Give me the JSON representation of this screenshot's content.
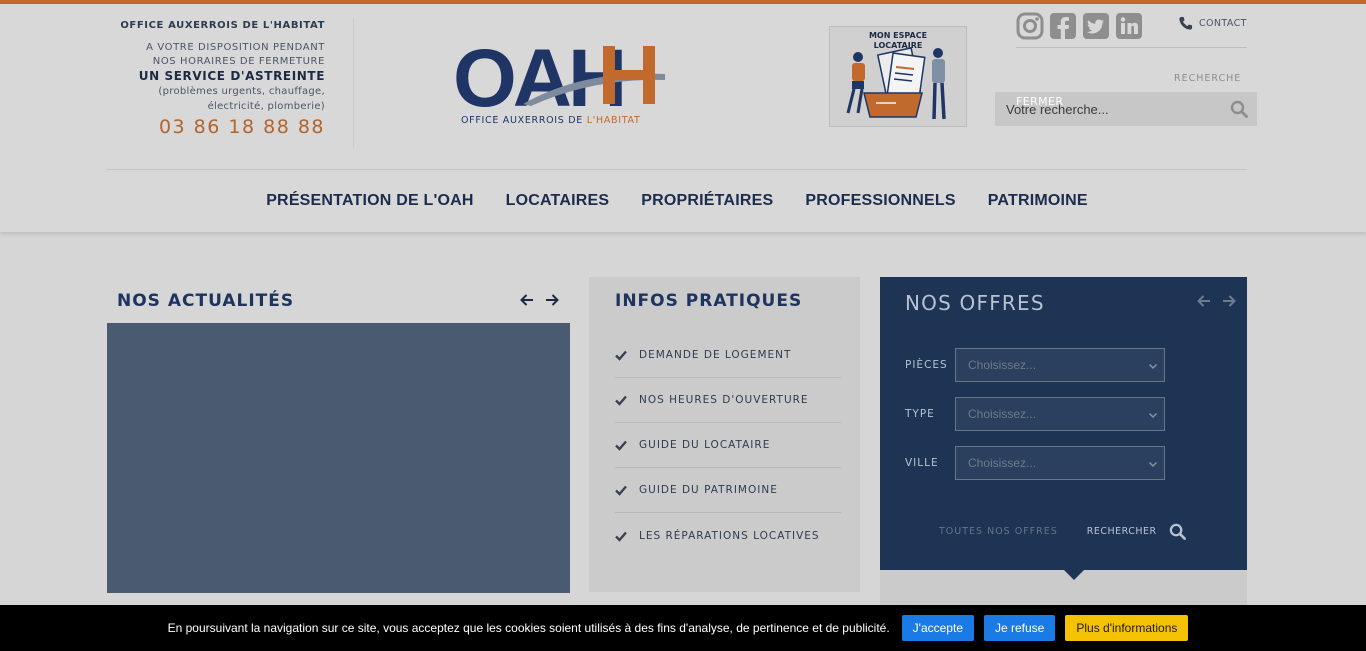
{
  "header": {
    "astreinte": {
      "org": "OFFICE AUXERROIS DE L'HABITAT",
      "line1": "A VOTRE DISPOSITION PENDANT",
      "line2": "NOS HORAIRES DE FERMETURE",
      "service": "UN SERVICE D'ASTREINTE",
      "detail1": "(problèmes urgents, chauffage,",
      "detail2": "électricité, plomberie)",
      "phone": "03 86 18 88 88"
    },
    "logo": {
      "letters": "OAH",
      "subtitle_main": "OFFICE AUXERROIS DE ",
      "subtitle_accent": "L'HABITAT"
    },
    "espace": {
      "label1": "MON ESPACE",
      "label2": "LOCATAIRE"
    },
    "social_icons": [
      "instagram-icon",
      "facebook-icon",
      "twitter-icon",
      "linkedin-icon"
    ],
    "contact_label": "CONTACT",
    "search_label": "RECHERCHE",
    "close_label": "FERMER",
    "search_placeholder": "Votre recherche..."
  },
  "nav": {
    "items": [
      "PRÉSENTATION DE L'OAH",
      "LOCATAIRES",
      "PROPRIÉTAIRES",
      "PROFESSIONNELS",
      "PATRIMOINE"
    ]
  },
  "actualites": {
    "title": "NOS ACTUALITÉS"
  },
  "infos": {
    "title": "INFOS PRATIQUES",
    "items": [
      "DEMANDE DE LOGEMENT",
      "NOS HEURES D'OUVERTURE",
      "GUIDE DU LOCATAIRE",
      "GUIDE DU PATRIMOINE",
      "LES RÉPARATIONS LOCATIVES"
    ]
  },
  "offres": {
    "title": "NOS OFFRES",
    "fields": [
      {
        "label": "PIÈCES",
        "value": "Choisissez..."
      },
      {
        "label": "TYPE",
        "value": "Choisissez..."
      },
      {
        "label": "VILLE",
        "value": "Choisissez..."
      }
    ],
    "all_label": "TOUTES NOS OFFRES",
    "search_label": "RECHERCHER"
  },
  "cookie": {
    "message": "En poursuivant la navigation sur ce site, vous acceptez que les cookies soient utilisés à des fins d'analyse, de pertinence et de publicité.",
    "accept": "J'accepte",
    "refuse": "Je refuse",
    "more": "Plus d'informations"
  },
  "colors": {
    "navy": "#1d3360",
    "orange": "#c26a2e",
    "accept_blue": "#1a7be6",
    "more_yellow": "#f5c200"
  }
}
